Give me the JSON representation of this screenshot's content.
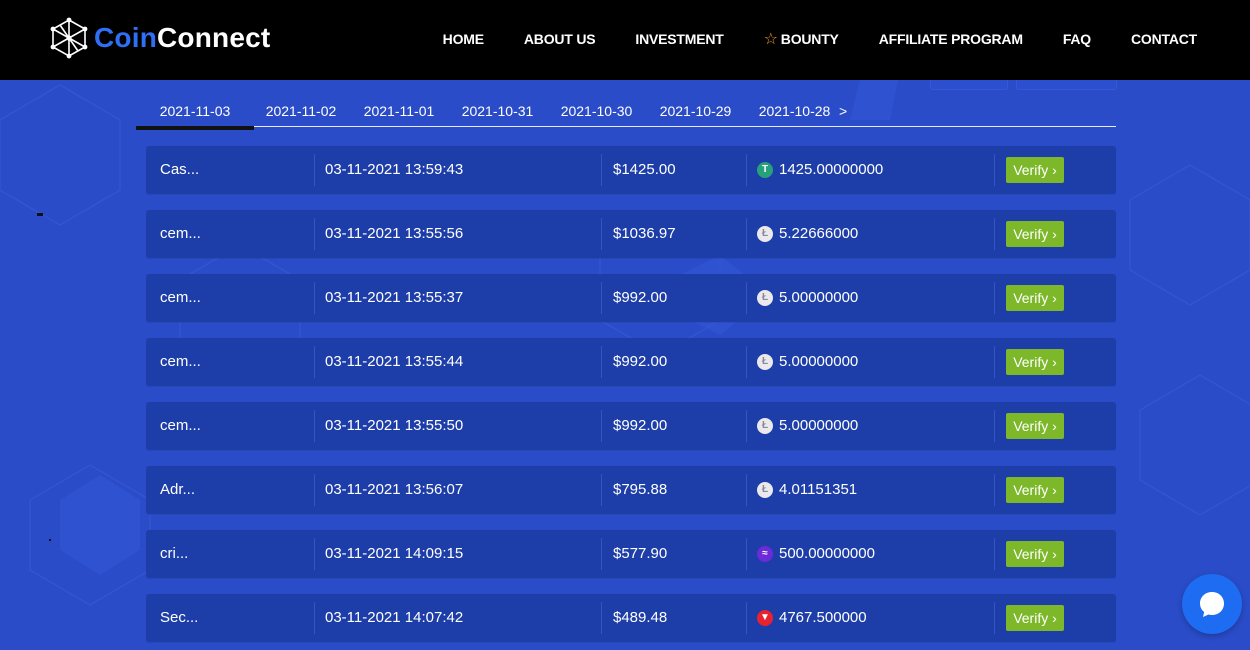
{
  "brand": {
    "name_part1": "Coin",
    "name_part2": "Connect"
  },
  "nav": {
    "items": [
      {
        "label": "HOME"
      },
      {
        "label": "ABOUT US"
      },
      {
        "label": "INVESTMENT"
      },
      {
        "label": "BOUNTY",
        "icon": "star-icon"
      },
      {
        "label": "AFFILIATE PROGRAM"
      },
      {
        "label": "FAQ"
      },
      {
        "label": "CONTACT"
      }
    ]
  },
  "tabs": {
    "active_index": 0,
    "dates": [
      "2021-11-03",
      "2021-11-02",
      "2021-11-01",
      "2021-10-31",
      "2021-10-30",
      "2021-10-29",
      "2021-10-28"
    ],
    "next_label": ">"
  },
  "transactions": [
    {
      "name": "Cas...",
      "datetime": "03-11-2021 13:59:43",
      "amount": "$1425.00",
      "coin": "usdt",
      "coin_amount": "1425.00000000",
      "action": "Verify ›"
    },
    {
      "name": "cem...",
      "datetime": "03-11-2021 13:55:56",
      "amount": "$1036.97",
      "coin": "ltc",
      "coin_amount": "5.22666000",
      "action": "Verify ›"
    },
    {
      "name": "cem...",
      "datetime": "03-11-2021 13:55:37",
      "amount": "$992.00",
      "coin": "ltc",
      "coin_amount": "5.00000000",
      "action": "Verify ›"
    },
    {
      "name": "cem...",
      "datetime": "03-11-2021 13:55:44",
      "amount": "$992.00",
      "coin": "ltc",
      "coin_amount": "5.00000000",
      "action": "Verify ›"
    },
    {
      "name": "cem...",
      "datetime": "03-11-2021 13:55:50",
      "amount": "$992.00",
      "coin": "ltc",
      "coin_amount": "5.00000000",
      "action": "Verify ›"
    },
    {
      "name": "Adr...",
      "datetime": "03-11-2021 13:56:07",
      "amount": "$795.88",
      "coin": "ltc",
      "coin_amount": "4.01151351",
      "action": "Verify ›"
    },
    {
      "name": "cri...",
      "datetime": "03-11-2021 14:09:15",
      "amount": "$577.90",
      "coin": "xlm",
      "coin_amount": "500.00000000",
      "action": "Verify ›"
    },
    {
      "name": "Sec...",
      "datetime": "03-11-2021 14:07:42",
      "amount": "$489.48",
      "coin": "trx",
      "coin_amount": "4767.500000",
      "action": "Verify ›"
    }
  ],
  "coin_icons": {
    "usdt": {
      "icon": "tether-icon",
      "glyph": "T",
      "color": "#26a17b"
    },
    "ltc": {
      "icon": "litecoin-icon",
      "glyph": "Ł",
      "color": "#e9e9ee"
    },
    "xlm": {
      "icon": "stellar-icon",
      "glyph": "≈",
      "color": "#6b2bd8"
    },
    "trx": {
      "icon": "tron-icon",
      "glyph": "▼",
      "color": "#e8232f"
    }
  },
  "colors": {
    "background": "#2a4cc9",
    "header": "#000000",
    "row": "#1d3ea8",
    "verify_button": "#7cb82a",
    "brand_accent": "#2f6ff5",
    "chat_bubble": "#1d6cf2"
  }
}
